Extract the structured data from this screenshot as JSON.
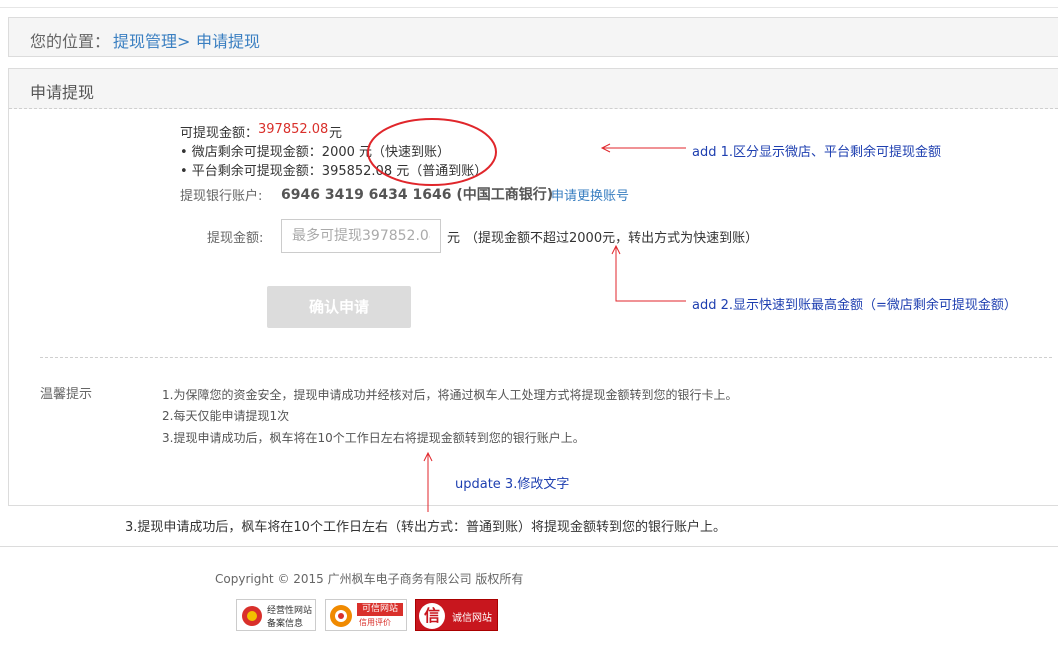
{
  "breadcrumb": {
    "label": "您的位置：",
    "item1": "提现管理>",
    "item2": "申请提现"
  },
  "panel": {
    "title": "申请提现"
  },
  "balance": {
    "available_label": "可提现金额：",
    "available_value": "397852.08",
    "available_unit": "元",
    "weidian_line": "• 微店剩余可提现金额：2000 元（快速到账）",
    "platform_line": "• 平台剩余可提现金额：395852.08 元（普通到账）"
  },
  "bank": {
    "label": "提现银行账户:",
    "account": "6946 3419 6434 1646 (中国工商银行)",
    "change_link": "申请更换账号"
  },
  "amount": {
    "label": "提现金额:",
    "placeholder": "最多可提现397852.08",
    "unit": "元",
    "hint": "（提现金额不超过2000元，转出方式为快速到账）"
  },
  "submit_label": "确认申请",
  "tips": {
    "title": "温馨提示",
    "lines": [
      "1.为保障您的资金安全，提现申请成功并经核对后，将通过枫车人工处理方式将提现金额转到您的银行卡上。",
      "2.每天仅能申请提现1次",
      "3.提现申请成功后，枫车将在10个工作日左右将提现金额转到您的银行账户上。"
    ]
  },
  "annotations": {
    "note1": "add 1.区分显示微店、平台剩余可提现金额",
    "note2": "add 2.显示快速到账最高金额（=微店剩余可提现金额）",
    "note3": "update 3.修改文字",
    "revised_text": "3.提现申请成功后，枫车将在10个工作日左右（转出方式：普通到账）将提现金额转到您的银行账户上。"
  },
  "footer": {
    "copyright": "Copyright © 2015 广州枫车电子商务有限公司 版权所有",
    "badge1_line1": "经营性网站",
    "badge1_line2": "备案信息",
    "badge2_line1": "可信网站",
    "badge2_line2": "信用评价",
    "badge3_char": "信",
    "badge3_text": "诚信网站"
  },
  "colors": {
    "link": "#3a7fc1",
    "amount_red": "#d9302b",
    "annotation_red": "#e0262b",
    "annotation_blue": "#1e3fb0"
  }
}
